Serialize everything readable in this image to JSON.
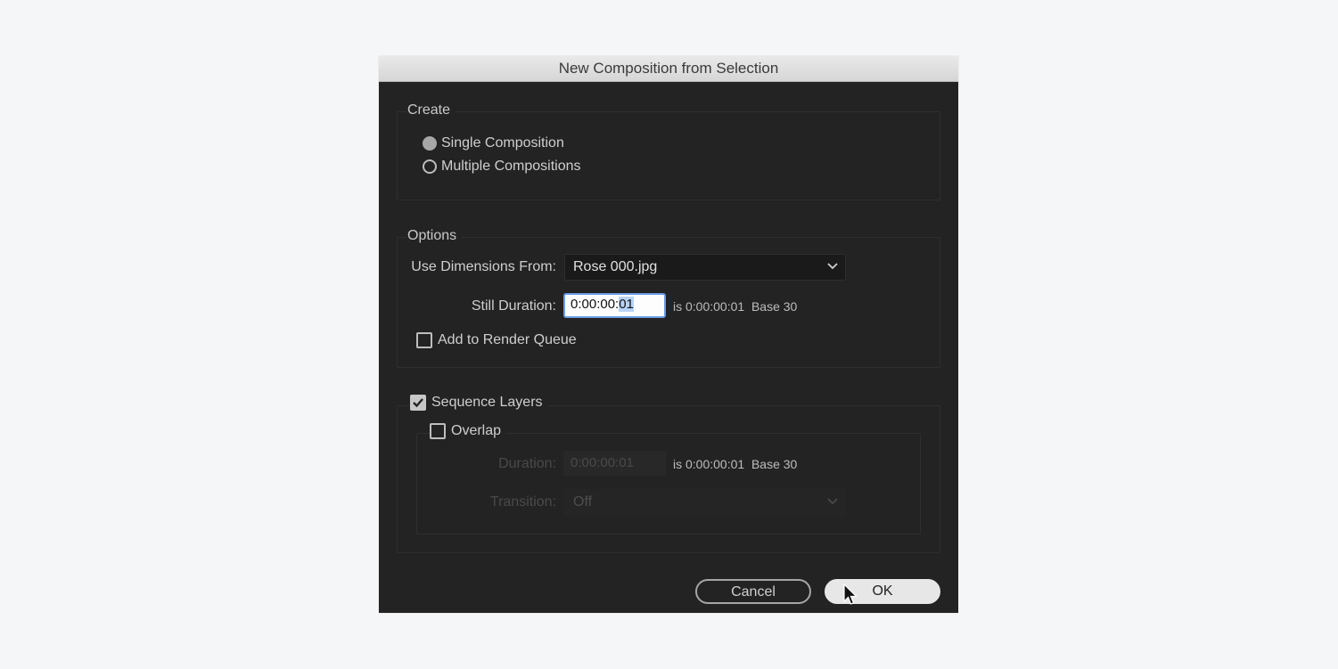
{
  "dialog": {
    "title": "New Composition from Selection"
  },
  "create": {
    "label": "Create",
    "options": [
      {
        "label": "Single Composition",
        "selected": true
      },
      {
        "label": "Multiple Compositions",
        "selected": false
      }
    ]
  },
  "options": {
    "label": "Options",
    "use_dimensions_label": "Use Dimensions From:",
    "use_dimensions_value": "Rose 000.jpg",
    "still_duration_label": "Still Duration:",
    "still_duration_value_plain": "0:00:00:",
    "still_duration_value_selected": "01",
    "still_duration_info": "is 0:00:00:01  Base 30",
    "add_to_render_queue_label": "Add to Render Queue",
    "add_to_render_queue_checked": false
  },
  "sequence": {
    "label": "Sequence Layers",
    "checked": true,
    "overlap_label": "Overlap",
    "overlap_checked": false,
    "duration_label": "Duration:",
    "duration_value": "0:00:00:01",
    "duration_info": "is 0:00:00:01  Base 30",
    "transition_label": "Transition:",
    "transition_value": "Off"
  },
  "buttons": {
    "cancel": "Cancel",
    "ok": "OK"
  },
  "colors": {
    "dialog_bg": "#232323",
    "page_bg": "#f5f6f8",
    "focus": "#6a9ee6"
  }
}
